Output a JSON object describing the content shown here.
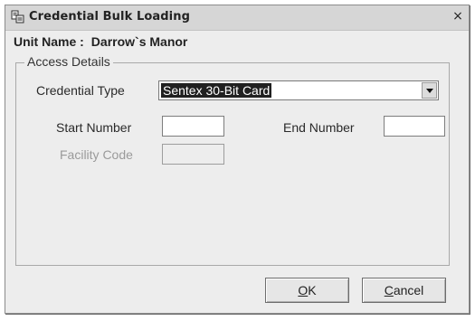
{
  "window": {
    "title": "Credential Bulk Loading",
    "close_glyph": "×",
    "icon": "app-window-icon"
  },
  "unit": {
    "label": "Unit Name :",
    "value": "Darrow`s Manor"
  },
  "access_details": {
    "group_title": "Access Details",
    "credential_type_label": "Credential Type",
    "credential_type_value": "Sentex 30-Bit Card",
    "start_number_label": "Start Number",
    "start_number_value": "",
    "end_number_label": "End Number",
    "end_number_value": "",
    "facility_code_label": "Facility Code",
    "facility_code_value": ""
  },
  "buttons": {
    "ok_mnemonic": "O",
    "ok_rest": "K",
    "cancel_mnemonic": "C",
    "cancel_rest": "ancel"
  }
}
